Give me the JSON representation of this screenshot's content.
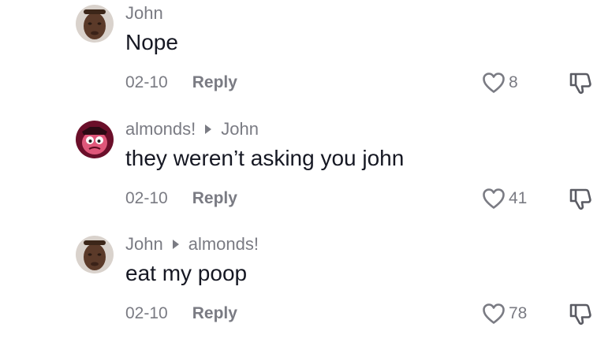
{
  "comments": [
    {
      "author": "John",
      "reply_to": "",
      "text": "Nope",
      "date": "02-10",
      "reply_label": "Reply",
      "likes": "8",
      "avatar": "man-face-avatar"
    },
    {
      "author": "almonds!",
      "reply_to": "John",
      "text": "they weren’t asking you john",
      "date": "02-10",
      "reply_label": "Reply",
      "likes": "41",
      "avatar": "cartoon-character-avatar"
    },
    {
      "author": "John",
      "reply_to": "almonds!",
      "text": "eat my poop",
      "date": "02-10",
      "reply_label": "Reply",
      "likes": "78",
      "avatar": "man-face-avatar"
    }
  ],
  "icons": {
    "like": "heart-icon",
    "dislike": "thumbs-down-icon",
    "reply_arrow": "play-arrow-icon"
  },
  "colors": {
    "text_primary": "#161823",
    "text_secondary": "#7a7b83",
    "background": "#ffffff"
  }
}
